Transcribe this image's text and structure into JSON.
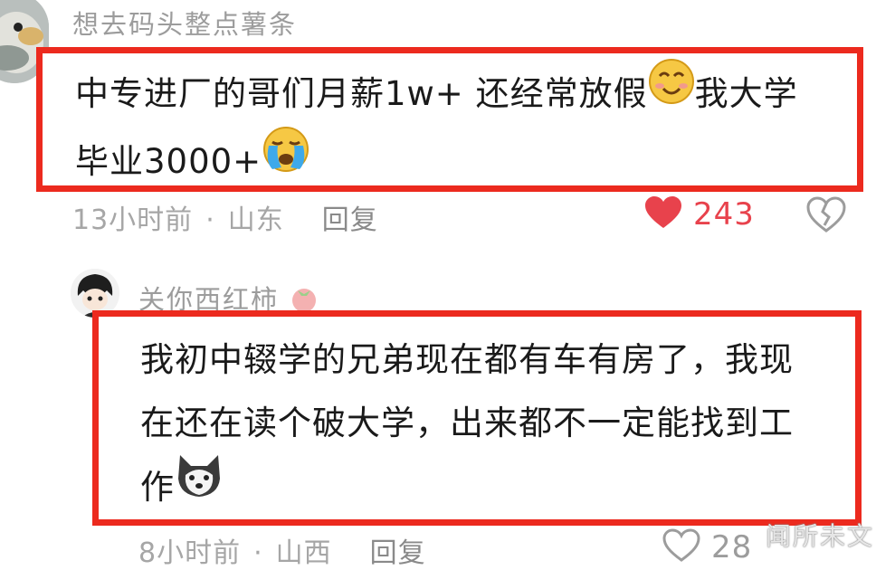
{
  "comments": [
    {
      "username": "想去码头整点薯条",
      "text_line1_a": "中专进厂的哥们月薪1w+  还经常放假",
      "text_line1_b": "我大学",
      "text_line2": "毕业3000+",
      "time": "13小时前",
      "separator": "·",
      "location": "山东",
      "reply_label": "回复",
      "like_count": "243",
      "liked": true
    },
    {
      "username": "关你西红柿",
      "text_line1": "我初中辍学的兄弟现在都有车有房了，我现",
      "text_line2": "在还在读个破大学，出来都不一定能找到工",
      "text_line3": "作",
      "time": "8小时前",
      "separator": "·",
      "location": "山西",
      "reply_label": "回复",
      "like_count": "28",
      "liked": false
    }
  ],
  "icons": {
    "smile_emoji": "smiling-face-emoji",
    "crying_emoji": "crying-face-emoji",
    "husky_emoji": "husky-dog-emoji",
    "like_icon": "heart-icon",
    "dislike_icon": "broken-heart-icon",
    "username_emoji": "tomato-icon"
  },
  "watermark": "闻所未文",
  "colors": {
    "highlight_border": "#ec2a1e",
    "liked_heart": "#e8424c",
    "meta_text": "#a6a6a6"
  }
}
